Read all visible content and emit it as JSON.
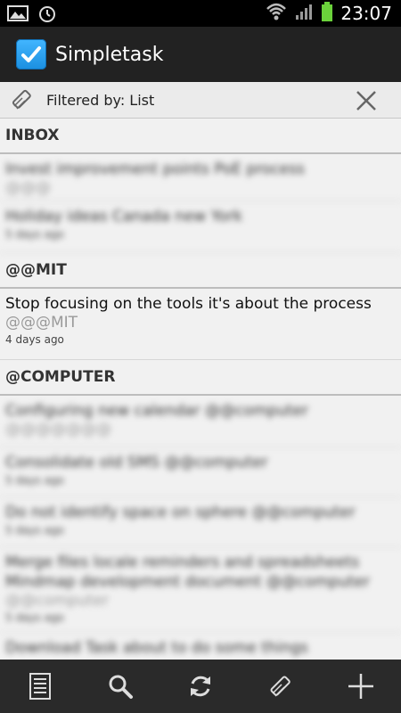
{
  "status_bar": {
    "time": "23:07"
  },
  "action_bar": {
    "title": "Simpletask"
  },
  "filter_bar": {
    "text": "Filtered by: List"
  },
  "sections": [
    {
      "header": "INBOX",
      "tasks": [
        {
          "text": "Invest improvement points PoE process",
          "tag": "@@@",
          "age": "",
          "blurred": true
        },
        {
          "text": "Holiday ideas Canada new York",
          "tag": "",
          "age": "5 days ago",
          "blurred": true
        }
      ]
    },
    {
      "header": "@@MIT",
      "tasks": [
        {
          "text": "Stop focusing on the tools it's about the process",
          "tag": "@@@MIT",
          "age": "4 days ago",
          "blurred": false
        }
      ]
    },
    {
      "header": "@COMPUTER",
      "tasks": [
        {
          "text": "Configuring new calendar @@computer",
          "tag": "@@@@@@@",
          "age": "",
          "blurred": true
        },
        {
          "text": "Consolidate old SMS @@computer",
          "tag": "",
          "age": "5 days ago",
          "blurred": true
        },
        {
          "text": "Do not identify space on sphere @@computer",
          "tag": "",
          "age": "5 days ago",
          "blurred": true
        },
        {
          "text": "Merge files locale reminders and spreadsheets Mindmap development document @@computer",
          "tag": "@@computer",
          "age": "5 days ago",
          "blurred": true
        },
        {
          "text": "Download Task about to do some things",
          "tag": "",
          "age": "",
          "blurred": true
        }
      ]
    }
  ],
  "bottom_bar": {
    "buttons": [
      "list-icon",
      "search-icon",
      "sync-icon",
      "edit-icon",
      "add-icon"
    ]
  }
}
